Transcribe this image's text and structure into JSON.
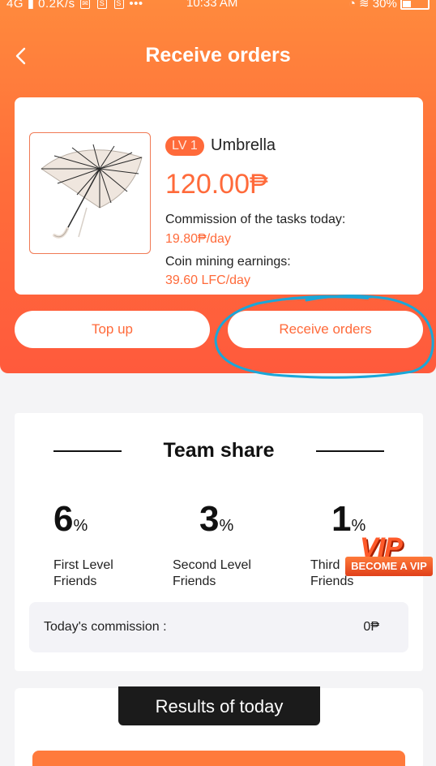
{
  "status_bar": {
    "network": "4G",
    "speed": "0.2K/s",
    "time": "10:33 AM",
    "battery": "30%"
  },
  "header": {
    "title": "Receive orders"
  },
  "product": {
    "level": "LV 1",
    "name": "Umbrella",
    "price": "120.00₱",
    "commission_label": "Commission of the tasks today:",
    "commission_value": "19.80₱/day",
    "mining_label": "Coin mining earnings:",
    "mining_value": "39.60 LFC/day"
  },
  "actions": {
    "top_up": "Top up",
    "receive_orders": "Receive orders"
  },
  "team_share": {
    "title": "Team share",
    "levels": [
      {
        "value": "6",
        "unit": "%",
        "line1": "First Level",
        "line2": "Friends"
      },
      {
        "value": "3",
        "unit": "%",
        "line1": "Second Level",
        "line2": "Friends"
      },
      {
        "value": "1",
        "unit": "%",
        "line1": "Third",
        "line2": "Friends"
      }
    ],
    "commission_label": "Today's commission :",
    "commission_value": "0₱"
  },
  "vip": {
    "big": "VIP",
    "tag": "BECOME A VIP"
  },
  "results": {
    "title": "Results of today"
  },
  "colors": {
    "accent": "#ff6a3a",
    "hero_top": "#ff8a3d",
    "hero_bottom": "#ff5a3c",
    "annotation": "#1aa7d8"
  }
}
